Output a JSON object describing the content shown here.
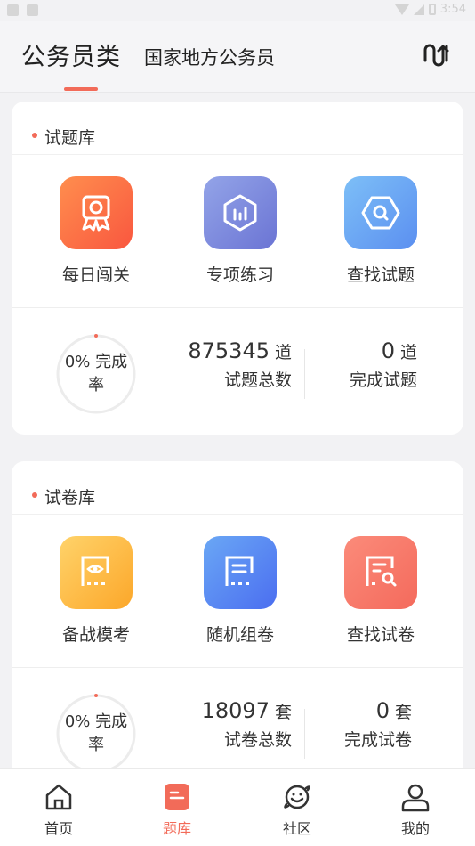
{
  "status_bar": {
    "time": "3:54"
  },
  "header": {
    "title": "公务员类",
    "subtitle": "国家地方公务员",
    "switch_icon": "switch-icon"
  },
  "question_bank": {
    "title": "试题库",
    "tiles": [
      {
        "label": "每日闯关",
        "icon": "award-icon"
      },
      {
        "label": "专项练习",
        "icon": "chart-icon"
      },
      {
        "label": "查找试题",
        "icon": "hex-search-icon"
      }
    ],
    "progress": {
      "label_top": "0% 完成",
      "label_bottom": "率",
      "value": 0
    },
    "total": {
      "number": "875345",
      "unit": "道",
      "label": "试题总数"
    },
    "done": {
      "number": "0",
      "unit": "道",
      "label": "完成试题"
    }
  },
  "paper_bank": {
    "title": "试卷库",
    "tiles": [
      {
        "label": "备战模考",
        "icon": "eye-doc-icon"
      },
      {
        "label": "随机组卷",
        "icon": "doc-icon"
      },
      {
        "label": "查找试卷",
        "icon": "doc-search-icon"
      }
    ],
    "progress": {
      "label_top": "0% 完成",
      "label_bottom": "率",
      "value": 0
    },
    "total": {
      "number": "18097",
      "unit": "套",
      "label": "试卷总数"
    },
    "done": {
      "number": "0",
      "unit": "套",
      "label": "完成试卷"
    }
  },
  "tabs": [
    {
      "label": "首页",
      "icon": "home-icon",
      "active": false
    },
    {
      "label": "题库",
      "icon": "question-bank-icon",
      "active": true
    },
    {
      "label": "社区",
      "icon": "planet-icon",
      "active": false
    },
    {
      "label": "我的",
      "icon": "user-icon",
      "active": false
    }
  ],
  "colors": {
    "accent": "#f26b59"
  }
}
